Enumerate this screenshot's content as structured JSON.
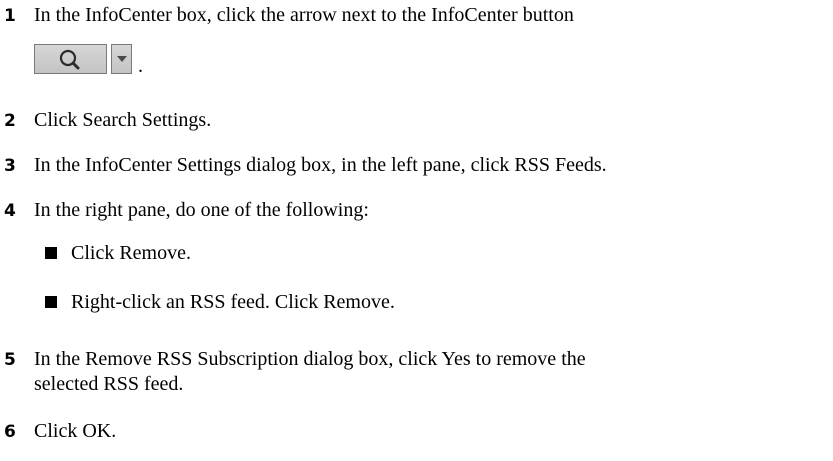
{
  "steps": [
    {
      "number": "1",
      "text": "In the InfoCenter box, click the arrow next to the InfoCenter button",
      "trailing": "."
    },
    {
      "number": "2",
      "text": "Click Search Settings."
    },
    {
      "number": "3",
      "text": "In the InfoCenter Settings dialog box, in the left pane, click RSS Feeds."
    },
    {
      "number": "4",
      "text": "In the right pane, do one of the following:",
      "bullets": [
        "Click Remove.",
        "Right-click an RSS feed. Click Remove."
      ]
    },
    {
      "number": "5",
      "lines": [
        "In the Remove RSS Subscription dialog box, click Yes to remove the",
        "selected RSS feed."
      ]
    },
    {
      "number": "6",
      "text": "Click OK."
    }
  ],
  "infocenter_button": {
    "icon": "magnifier-icon",
    "arrow_icon": "chevron-down-icon"
  }
}
